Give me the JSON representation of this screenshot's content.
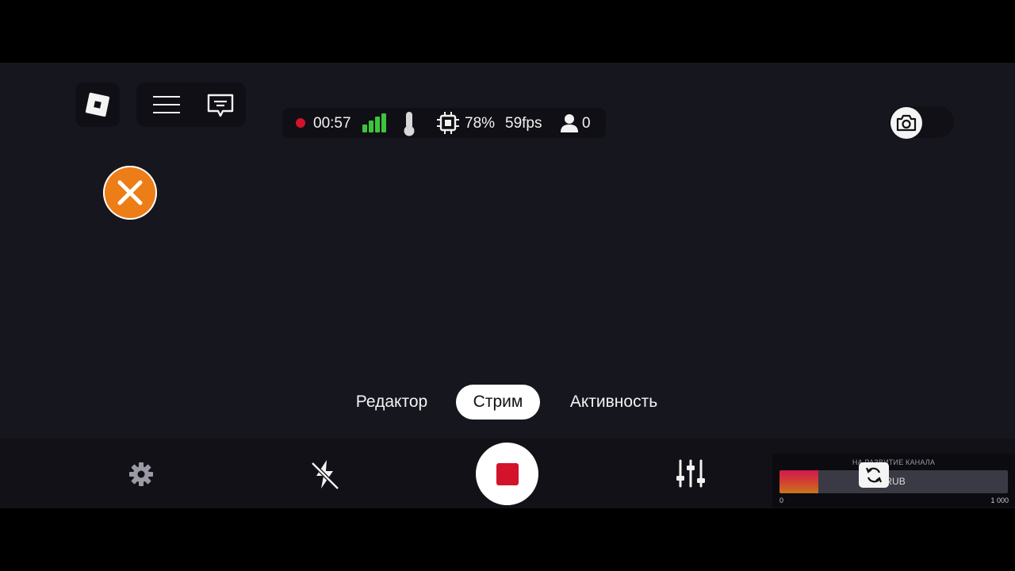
{
  "status": {
    "timer": "00:57",
    "cpu": "78%",
    "fps": "59fps",
    "viewers": "0"
  },
  "tabs": [
    {
      "label": "Редактор",
      "active": false
    },
    {
      "label": "Стрим",
      "active": true
    },
    {
      "label": "Активность",
      "active": false
    }
  ],
  "donation": {
    "title": "НА РАЗВИТИЕ КАНАЛА",
    "amount": "000 RUB",
    "min": "0",
    "max": "1 000",
    "progress": 0.17
  },
  "colors": {
    "accent_orange": "#ed7d16",
    "record_red": "#d3132b",
    "signal_green": "#3ec43a"
  },
  "icons": {
    "logo": "roblox-logo-icon",
    "menu": "hamburger-menu-icon",
    "chat": "chat-icon",
    "close": "close-icon",
    "camera": "camera-icon",
    "settings": "gear-icon",
    "flash": "flash-off-icon",
    "record": "stop-record-icon",
    "adjust": "sliders-icon",
    "flip": "flip-camera-icon"
  }
}
